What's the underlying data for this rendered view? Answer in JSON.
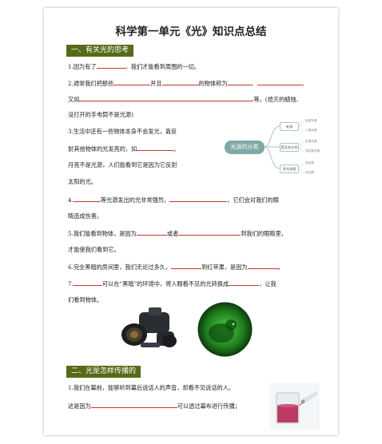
{
  "doc": {
    "title": "科学第一单元《光》知识点总结"
  },
  "section1": {
    "heading": "一、有关光的思考",
    "q1": {
      "pre": "1.因为有了",
      "post": "，我们才能看到周围的一切。"
    },
    "q2": {
      "a": "2.通常我们把那些",
      "b": "并且",
      "c": "的物体称为",
      "d": "、",
      "e": "、",
      "l2a": "又如",
      "l2b": "等。(熄灭的蜡烛、",
      "l3": "没打开的手电筒不是光源)"
    },
    "q3": {
      "l1": "3.生活中还有一些物体本身不会发光，靠反",
      "l2a": "射其他物体的光发亮的，如",
      "l2b": "。",
      "l3": "月亮不是光源，人们能看到它是因为它反射",
      "l4": "太阳的光。"
    },
    "q4": {
      "a": "4.",
      "b": "等光源发出的光非常强烈，",
      "c": "，它们会对我们的眼",
      "l2": "睛造成伤害。"
    },
    "q5": {
      "a": "5.我们能看到物体，是因为",
      "b": "或者",
      "c": "到我们的眼睛里，",
      "l2": "才能使我们看到它。"
    },
    "q6": {
      "a": "6.完全黑暗的房间里，我们无论过多久，",
      "b": "到红苹果，是因为",
      "c": "。"
    },
    "q7": {
      "a": "7.",
      "b": "可以在“黑暗”的环境中，将人眼看不见的光转换成",
      "c": "，让我",
      "l2": "们看到物体。"
    }
  },
  "mindmap": {
    "center": "光源的分类",
    "branches": [
      {
        "label": "来源",
        "leaves": [
          "自然光源",
          "人造光源"
        ]
      },
      {
        "label": "是否有生命",
        "leaves": [
          "生物光源",
          "非生物光源"
        ]
      },
      {
        "label": "发光原理",
        "leaves": [
          "热光源",
          "冷光源"
        ]
      }
    ]
  },
  "section2": {
    "heading": "二、光是怎样传播的",
    "q1": {
      "l1": "1.我们在幕前，能够听到幕后说话人的声音，却看不见说话的人。",
      "l2a": "这是因为",
      "l2b": "可以透过幕布进行传播；"
    }
  },
  "colors": {
    "heading_bg": "#566b18",
    "blank_line": "#c0392b",
    "mindmap": "#7fa9a5"
  }
}
